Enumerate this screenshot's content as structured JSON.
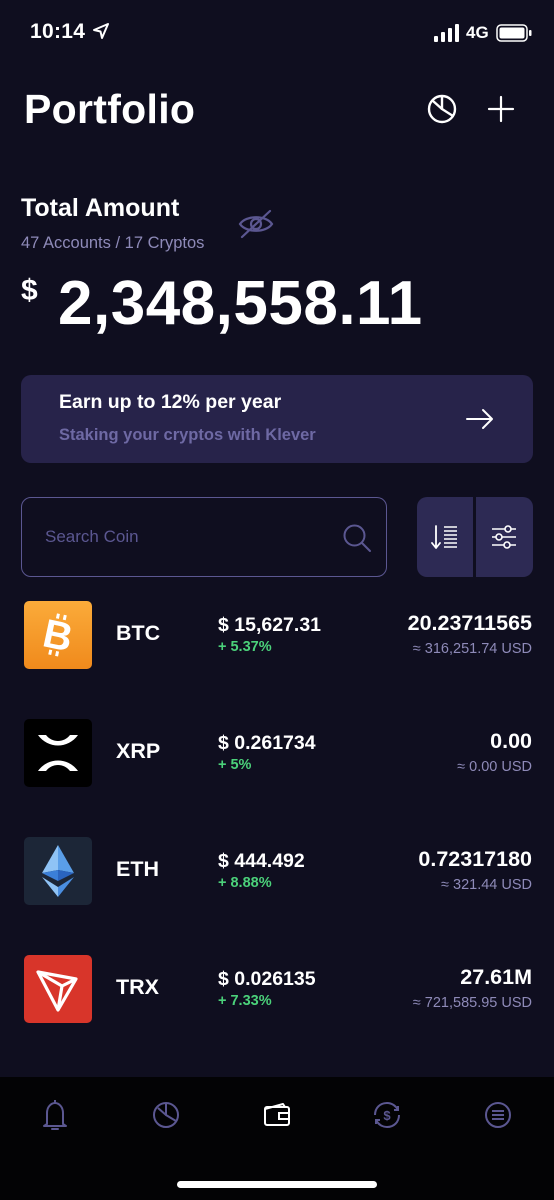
{
  "status_bar": {
    "time": "10:14",
    "network": "4G"
  },
  "header": {
    "title": "Portfolio",
    "icons": [
      "pie-chart-icon",
      "plus-icon"
    ]
  },
  "summary": {
    "label": "Total Amount",
    "subtitle": "47 Accounts / 17 Cryptos",
    "currency_symbol": "$",
    "total": "2,348,558.11"
  },
  "staking_banner": {
    "title": "Earn up to 12% per year",
    "subtitle": "Staking your cryptos with Klever"
  },
  "search": {
    "placeholder": "Search Coin"
  },
  "coins": [
    {
      "symbol": "BTC",
      "price": "$ 15,627.31",
      "change": "+ 5.37%",
      "amount": "20.23711565",
      "usd": "≈ 316,251.74 USD",
      "logo_color": "#f7931a"
    },
    {
      "symbol": "XRP",
      "price": "$ 0.261734",
      "change": "+ 5%",
      "amount": "0.00",
      "usd": "≈ 0.00 USD",
      "logo_color": "#000000"
    },
    {
      "symbol": "ETH",
      "price": "$ 444.492",
      "change": "+ 8.88%",
      "amount": "0.72317180",
      "usd": "≈ 321.44 USD",
      "logo_color": "#1c2637"
    },
    {
      "symbol": "TRX",
      "price": "$ 0.026135",
      "change": "+ 7.33%",
      "amount": "27.61M",
      "usd": "≈ 721,585.95 USD",
      "logo_color": "#d8352a"
    }
  ],
  "tab_bar": {
    "items": [
      "bell-icon",
      "pie-chart-icon",
      "wallet-icon",
      "exchange-icon",
      "menu-icon"
    ],
    "active": "wallet-icon"
  },
  "colors": {
    "background": "#0f0e1f",
    "card": "#27234a",
    "positive": "#4bd17a",
    "muted_text": "#8e8ab8",
    "accent_border": "#5b5791"
  }
}
